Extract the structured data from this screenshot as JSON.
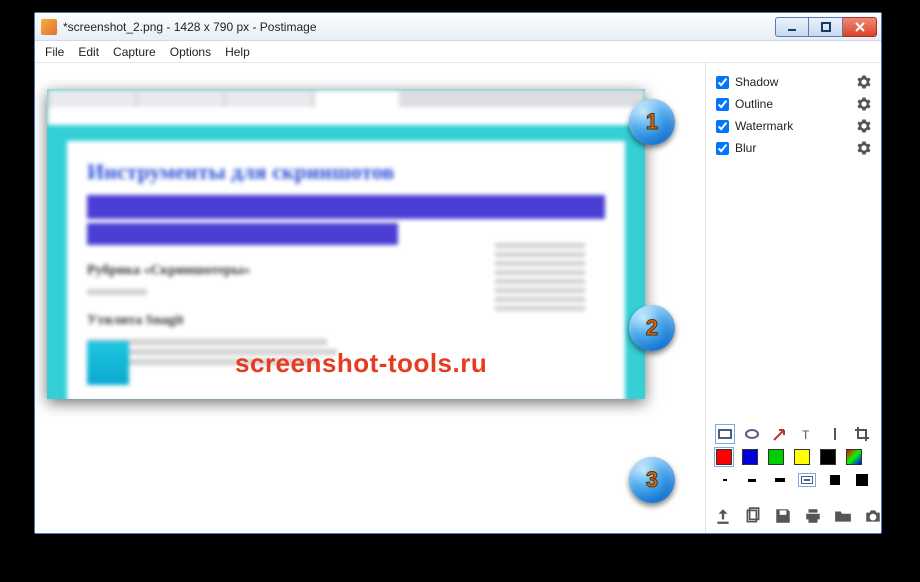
{
  "titlebar": {
    "title": "*screenshot_2.png - 1428 x 790 px - Postimage"
  },
  "menu": {
    "file": "File",
    "edit": "Edit",
    "capture": "Capture",
    "options": "Options",
    "help": "Help"
  },
  "effects": {
    "shadow": {
      "label": "Shadow",
      "checked": true
    },
    "outline": {
      "label": "Outline",
      "checked": true
    },
    "watermark": {
      "label": "Watermark",
      "checked": true
    },
    "blur": {
      "label": "Blur",
      "checked": true
    }
  },
  "tools": {
    "shapes": [
      "rectangle",
      "ellipse",
      "arrow",
      "text",
      "line",
      "crop"
    ],
    "active_shape": "rectangle",
    "colors": [
      "#ff0000",
      "#0000dd",
      "#00cc00",
      "#ffff00",
      "#000000",
      "rainbow"
    ],
    "active_color": "#ff0000",
    "stroke_sizes": [
      1,
      2,
      3,
      4,
      5,
      6
    ],
    "active_stroke": 4
  },
  "actions": [
    "upload",
    "copy",
    "save",
    "print",
    "open",
    "camera"
  ],
  "canvas": {
    "page_heading": "Инструменты для скриншотов",
    "section1": "Рубрика «Скриншотеры»",
    "section2": "Утилита Snagit",
    "watermark_text": "screenshot-tools.ru"
  },
  "annotations": {
    "b1": "1",
    "b2": "2",
    "b3": "3"
  }
}
